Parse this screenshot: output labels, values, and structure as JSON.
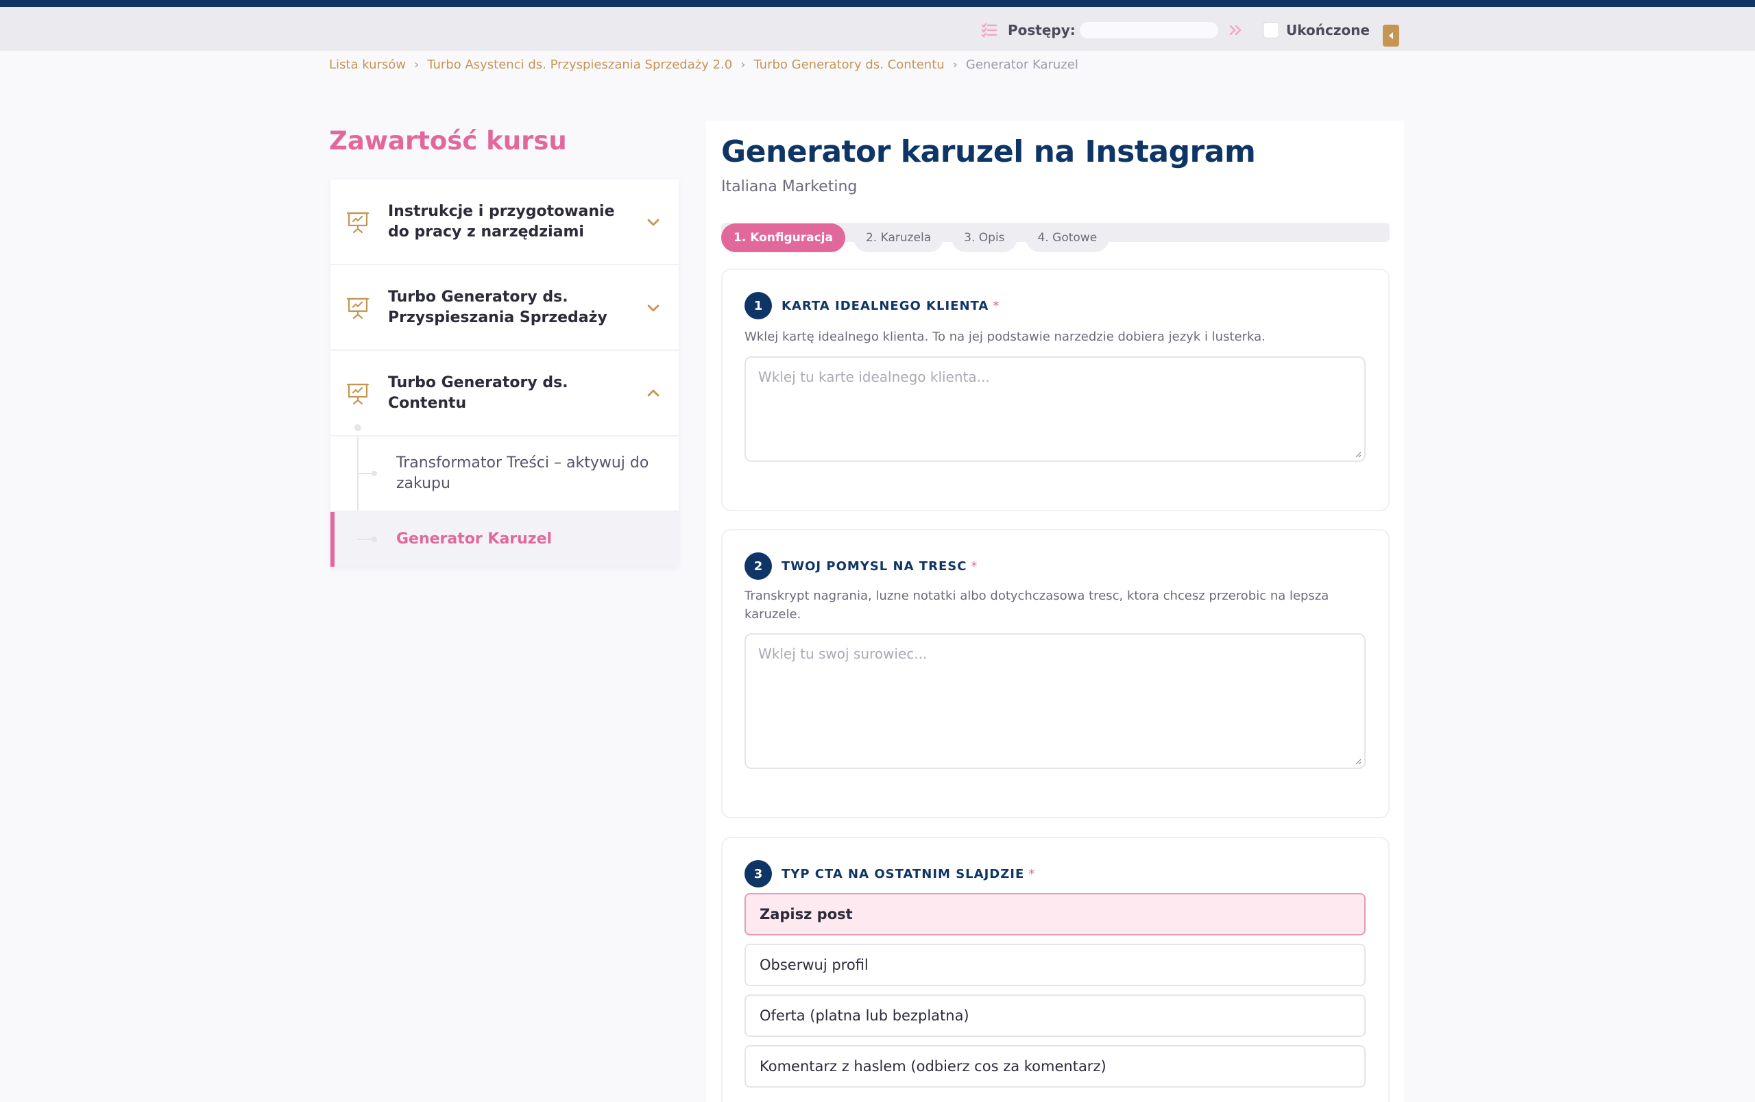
{
  "topbar": {
    "progress_label": "Postępy:",
    "progress_fraction": 0,
    "done_label": "Ukończone",
    "done_checked": false
  },
  "breadcrumb": [
    "Lista kursów",
    "Turbo Asystenci ds. Przyspieszania Sprzedaży 2.0",
    "Turbo Generatory ds. Contentu",
    "Generator Karuzel"
  ],
  "sidebar": {
    "title": "Zawartość kursu",
    "modules": [
      {
        "label": "Instrukcje i przygotowanie do pracy z narzędziami",
        "icon": "presentation-icon",
        "expanded": false
      },
      {
        "label": "Turbo Generatory ds. Przyspieszania Sprzedaży",
        "icon": "presentation-icon",
        "expanded": false
      },
      {
        "label": "Turbo Generatory ds. Contentu",
        "icon": "presentation-icon",
        "expanded": true
      }
    ],
    "lessons": [
      {
        "label": "Transformator Treści – aktywuj do zakupu",
        "active": false
      },
      {
        "label": "Generator Karuzel",
        "active": true
      }
    ]
  },
  "main": {
    "title": "Generator karuzel na Instagram",
    "subtitle": "Italiana Marketing",
    "steps": [
      "1. Konfiguracja",
      "2. Karuzela",
      "3. Opis",
      "4. Gotowe"
    ],
    "active_step": 0,
    "sections": [
      {
        "number": "1",
        "title": "KARTA IDEALNEGO KLIENTA",
        "required": "*",
        "description": "Wklej kartę idealnego klienta. To na jej podstawie narzedzie dobiera jezyk i lusterka.",
        "placeholder": "Wklej tu karte idealnego klienta..."
      },
      {
        "number": "2",
        "title": "TWOJ POMYSL NA TRESC",
        "required": "*",
        "description": "Transkrypt nagrania, luzne notatki albo dotychczasowa tresc, ktora chcesz przerobic na lepsza karuzele.",
        "placeholder": "Wklej tu swoj surowiec..."
      },
      {
        "number": "3",
        "title": "TYP CTA NA OSTATNIM SLAJDZIE",
        "required": "*",
        "options": [
          "Zapisz post",
          "Obserwuj profil",
          "Oferta (platna lub bezplatna)",
          "Komentarz z haslem (odbierz cos za komentarz)"
        ],
        "selected": "Zapisz post"
      }
    ]
  },
  "colors": {
    "navy": "#0e3566",
    "pink": "#e2689b",
    "gold": "#c59553",
    "selected_bg": "#fde9ef"
  }
}
